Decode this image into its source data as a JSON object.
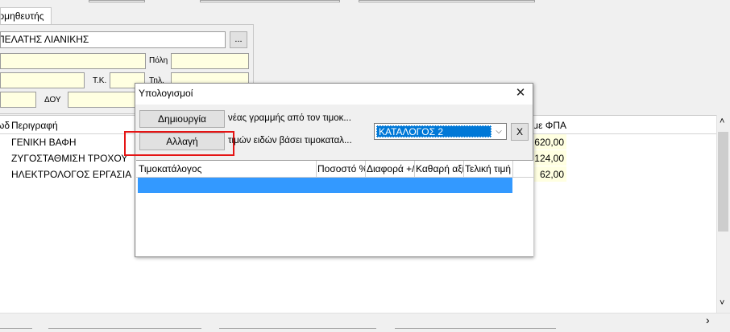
{
  "supplier_tab": {
    "tab_label": "Προμηθευτής",
    "customer_name": "ΠΕΛΑΤΗΣ ΛΙΑΝΙΚΗΣ",
    "ellipsis": "...",
    "label_city": "Πόλη",
    "label_zip": "Τ.Κ.",
    "label_phone": "Τηλ.",
    "label_tax_office": "ΔΟΥ"
  },
  "grid": {
    "columns": {
      "code": "Κωδ",
      "description": "Περιγραφή",
      "total_vat": "Σύνολο με ΦΠΑ"
    },
    "rows": [
      {
        "description": "ΓΕΝΙΚΗ ΒΑΦΗ",
        "total": "620,00"
      },
      {
        "description": "ΖΥΓΟΣΤΑΘΜΙΣΗ ΤΡΟΧΟΥ",
        "total": "124,00"
      },
      {
        "description": "ΗΛΕΚΤΡΟΛΟΓΟΣ ΕΡΓΑΣΙΑ",
        "total": "62,00"
      }
    ],
    "scroll_up": "˄",
    "scroll_down": "˅",
    "scroll_right": "›"
  },
  "dialog": {
    "title": "Υπολογισμοί",
    "close": "✕",
    "create_button": "Δημιουργία",
    "create_desc": "νέας γραμμής από τον τιμοκ...",
    "change_button": "Αλλαγή",
    "change_desc": "τιμών ειδών βάσει τιμοκαταλ...",
    "pricelist_value": "ΚΑΤΑΛΟΓΟΣ 2",
    "dropdown_arrow": "⌵",
    "x_button": "X",
    "columns": [
      "Τιμοκατάλογος",
      "Ποσοστό %",
      "Διαφορά +/-",
      "Καθαρή αξία",
      "Τελική τιμή"
    ]
  },
  "colors": {
    "highlight_border": "#e51414",
    "selection": "#3399ff",
    "yellow_field": "#ffffe1"
  }
}
